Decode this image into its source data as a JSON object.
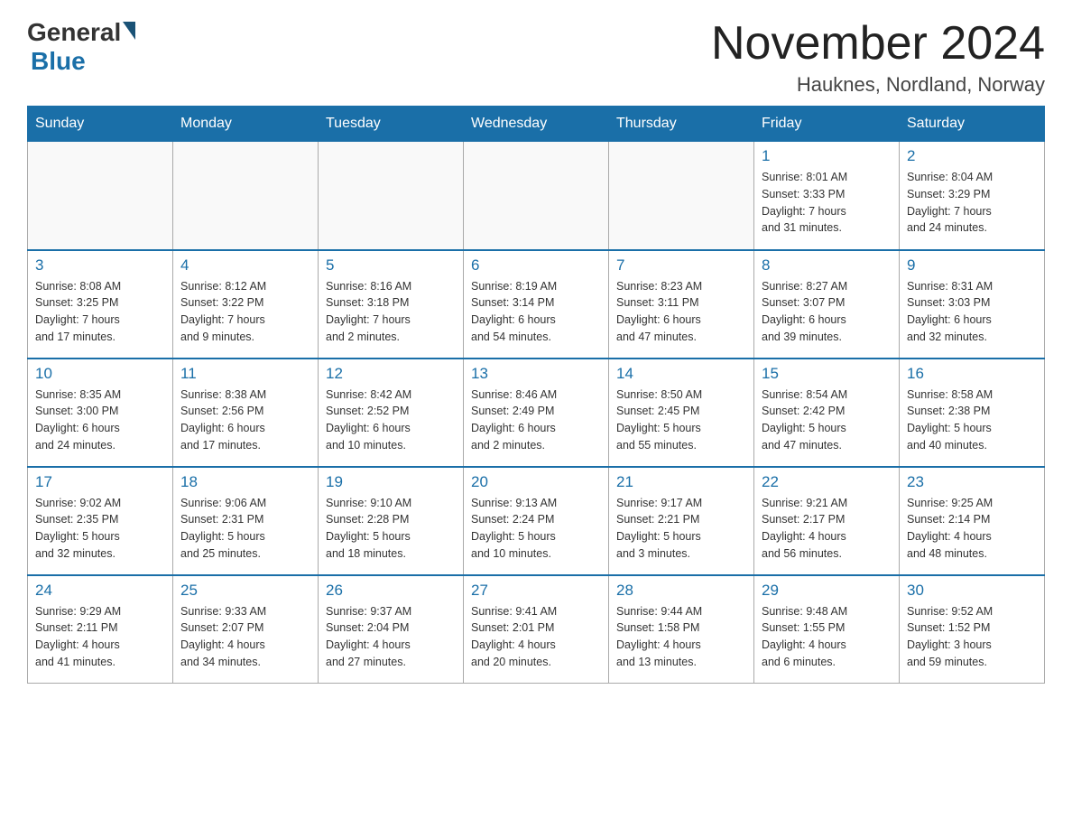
{
  "header": {
    "logo_general": "General",
    "logo_blue": "Blue",
    "month_title": "November 2024",
    "location": "Hauknes, Nordland, Norway"
  },
  "weekdays": [
    "Sunday",
    "Monday",
    "Tuesday",
    "Wednesday",
    "Thursday",
    "Friday",
    "Saturday"
  ],
  "weeks": [
    [
      {
        "day": "",
        "info": ""
      },
      {
        "day": "",
        "info": ""
      },
      {
        "day": "",
        "info": ""
      },
      {
        "day": "",
        "info": ""
      },
      {
        "day": "",
        "info": ""
      },
      {
        "day": "1",
        "info": "Sunrise: 8:01 AM\nSunset: 3:33 PM\nDaylight: 7 hours\nand 31 minutes."
      },
      {
        "day": "2",
        "info": "Sunrise: 8:04 AM\nSunset: 3:29 PM\nDaylight: 7 hours\nand 24 minutes."
      }
    ],
    [
      {
        "day": "3",
        "info": "Sunrise: 8:08 AM\nSunset: 3:25 PM\nDaylight: 7 hours\nand 17 minutes."
      },
      {
        "day": "4",
        "info": "Sunrise: 8:12 AM\nSunset: 3:22 PM\nDaylight: 7 hours\nand 9 minutes."
      },
      {
        "day": "5",
        "info": "Sunrise: 8:16 AM\nSunset: 3:18 PM\nDaylight: 7 hours\nand 2 minutes."
      },
      {
        "day": "6",
        "info": "Sunrise: 8:19 AM\nSunset: 3:14 PM\nDaylight: 6 hours\nand 54 minutes."
      },
      {
        "day": "7",
        "info": "Sunrise: 8:23 AM\nSunset: 3:11 PM\nDaylight: 6 hours\nand 47 minutes."
      },
      {
        "day": "8",
        "info": "Sunrise: 8:27 AM\nSunset: 3:07 PM\nDaylight: 6 hours\nand 39 minutes."
      },
      {
        "day": "9",
        "info": "Sunrise: 8:31 AM\nSunset: 3:03 PM\nDaylight: 6 hours\nand 32 minutes."
      }
    ],
    [
      {
        "day": "10",
        "info": "Sunrise: 8:35 AM\nSunset: 3:00 PM\nDaylight: 6 hours\nand 24 minutes."
      },
      {
        "day": "11",
        "info": "Sunrise: 8:38 AM\nSunset: 2:56 PM\nDaylight: 6 hours\nand 17 minutes."
      },
      {
        "day": "12",
        "info": "Sunrise: 8:42 AM\nSunset: 2:52 PM\nDaylight: 6 hours\nand 10 minutes."
      },
      {
        "day": "13",
        "info": "Sunrise: 8:46 AM\nSunset: 2:49 PM\nDaylight: 6 hours\nand 2 minutes."
      },
      {
        "day": "14",
        "info": "Sunrise: 8:50 AM\nSunset: 2:45 PM\nDaylight: 5 hours\nand 55 minutes."
      },
      {
        "day": "15",
        "info": "Sunrise: 8:54 AM\nSunset: 2:42 PM\nDaylight: 5 hours\nand 47 minutes."
      },
      {
        "day": "16",
        "info": "Sunrise: 8:58 AM\nSunset: 2:38 PM\nDaylight: 5 hours\nand 40 minutes."
      }
    ],
    [
      {
        "day": "17",
        "info": "Sunrise: 9:02 AM\nSunset: 2:35 PM\nDaylight: 5 hours\nand 32 minutes."
      },
      {
        "day": "18",
        "info": "Sunrise: 9:06 AM\nSunset: 2:31 PM\nDaylight: 5 hours\nand 25 minutes."
      },
      {
        "day": "19",
        "info": "Sunrise: 9:10 AM\nSunset: 2:28 PM\nDaylight: 5 hours\nand 18 minutes."
      },
      {
        "day": "20",
        "info": "Sunrise: 9:13 AM\nSunset: 2:24 PM\nDaylight: 5 hours\nand 10 minutes."
      },
      {
        "day": "21",
        "info": "Sunrise: 9:17 AM\nSunset: 2:21 PM\nDaylight: 5 hours\nand 3 minutes."
      },
      {
        "day": "22",
        "info": "Sunrise: 9:21 AM\nSunset: 2:17 PM\nDaylight: 4 hours\nand 56 minutes."
      },
      {
        "day": "23",
        "info": "Sunrise: 9:25 AM\nSunset: 2:14 PM\nDaylight: 4 hours\nand 48 minutes."
      }
    ],
    [
      {
        "day": "24",
        "info": "Sunrise: 9:29 AM\nSunset: 2:11 PM\nDaylight: 4 hours\nand 41 minutes."
      },
      {
        "day": "25",
        "info": "Sunrise: 9:33 AM\nSunset: 2:07 PM\nDaylight: 4 hours\nand 34 minutes."
      },
      {
        "day": "26",
        "info": "Sunrise: 9:37 AM\nSunset: 2:04 PM\nDaylight: 4 hours\nand 27 minutes."
      },
      {
        "day": "27",
        "info": "Sunrise: 9:41 AM\nSunset: 2:01 PM\nDaylight: 4 hours\nand 20 minutes."
      },
      {
        "day": "28",
        "info": "Sunrise: 9:44 AM\nSunset: 1:58 PM\nDaylight: 4 hours\nand 13 minutes."
      },
      {
        "day": "29",
        "info": "Sunrise: 9:48 AM\nSunset: 1:55 PM\nDaylight: 4 hours\nand 6 minutes."
      },
      {
        "day": "30",
        "info": "Sunrise: 9:52 AM\nSunset: 1:52 PM\nDaylight: 3 hours\nand 59 minutes."
      }
    ]
  ]
}
